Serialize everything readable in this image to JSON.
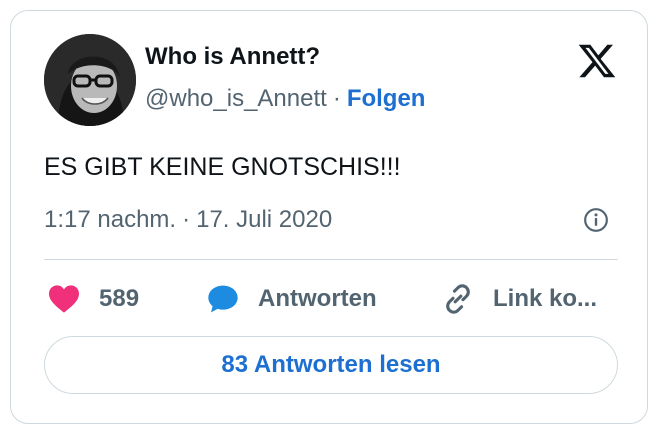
{
  "tweet": {
    "author_name": "Who is Annett?",
    "handle": "@who_is_Annett",
    "separator": "·",
    "follow_label": "Folgen",
    "text": "ES GIBT KEINE GNOTSCHIS!!!",
    "time": "1:17 nachm.",
    "date": "17. Juli 2020"
  },
  "actions": {
    "like_count": "589",
    "reply_label": "Antworten",
    "link_label": "Link ko..."
  },
  "read_replies_label": "83 Antworten lesen",
  "icons": {
    "x_logo": "x-logo-icon",
    "info": "info-icon",
    "like": "heart-icon",
    "reply": "speech-bubble-icon",
    "link": "link-icon"
  },
  "colors": {
    "accent_blue": "#1d6fd1",
    "like_pink": "#f0307a",
    "reply_blue": "#1d8be0",
    "muted_text": "#536471",
    "border": "#cfd9de"
  }
}
